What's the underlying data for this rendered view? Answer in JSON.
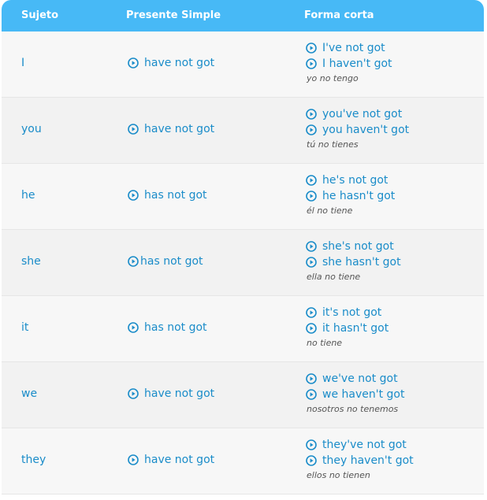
{
  "header": {
    "col_subject": "Sujeto",
    "col_present": "Presente Simple",
    "col_short": "Forma corta"
  },
  "rows": [
    {
      "subject": "I",
      "present": "have not got",
      "short1": "I've not got",
      "short2": "I haven't got",
      "translation": "yo no tengo"
    },
    {
      "subject": "you",
      "present": "have not got",
      "short1": "you've not got",
      "short2": "you haven't got",
      "translation": "tú no tienes"
    },
    {
      "subject": "he",
      "present": "has not got",
      "short1": "he's not got",
      "short2": "he hasn't got",
      "translation": "él no tiene"
    },
    {
      "subject": "she",
      "present": "has not got",
      "short1": "she's not got",
      "short2": "she hasn't got",
      "translation": "ella no tiene"
    },
    {
      "subject": "it",
      "present": "has not got",
      "short1": "it's not got",
      "short2": "it hasn't got",
      "translation": "no tiene"
    },
    {
      "subject": "we",
      "present": "have not got",
      "short1": "we've not got",
      "short2": "we haven't got",
      "translation": "nosotros no tenemos"
    },
    {
      "subject": "they",
      "present": "have not got",
      "short1": "they've not got",
      "short2": "they haven't got",
      "translation": "ellos no tienen"
    }
  ],
  "colors": {
    "header_bg": "#47b9f6",
    "link_blue": "#1a8cc9",
    "translation_gray": "#555555"
  },
  "icons": {
    "audio": "play-circle-icon"
  }
}
